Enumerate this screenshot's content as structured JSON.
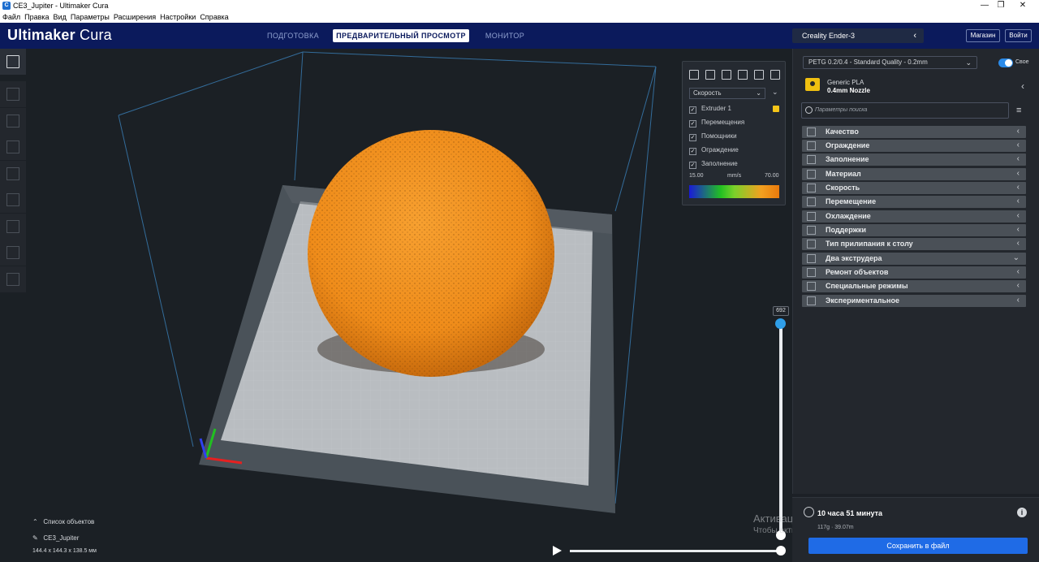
{
  "window": {
    "title": "CE3_Jupiter - Ultimaker Cura",
    "icon": "cura-app-icon",
    "controls": [
      "—",
      "❐",
      "✕"
    ]
  },
  "menu": [
    "Файл",
    "Правка",
    "Вид",
    "Параметры",
    "Расширения",
    "Настройки",
    "Справка"
  ],
  "header": {
    "logo_bold": "Ultimaker",
    "logo_light": "Cura",
    "tabs": [
      {
        "label": "ПОДГОТОВКА",
        "active": false
      },
      {
        "label": "ПРЕДВАРИТЕЛЬНЫЙ ПРОСМОТР",
        "active": true
      },
      {
        "label": "МОНИТОР",
        "active": false
      }
    ],
    "printer": "Creality Ender-3",
    "marketplace_label": "Магазин",
    "signin_label": "Войти"
  },
  "view_panel": {
    "color_scheme": "Скорость",
    "legend": [
      {
        "label": "Extruder 1",
        "checked": true,
        "swatch": "#f5c518"
      },
      {
        "label": "Перемещения",
        "checked": true
      },
      {
        "label": "Помощники",
        "checked": true
      },
      {
        "label": "Ограждение",
        "checked": true
      },
      {
        "label": "Заполнение",
        "checked": true
      }
    ],
    "scale_min": "15.00",
    "scale_unit": "mm/s",
    "scale_max": "70.00"
  },
  "layer": {
    "current": "692"
  },
  "objects": {
    "list_label": "Список объектов",
    "name": "CE3_Jupiter",
    "dimensions": "144.4 x 144.3 x 138.5 мм"
  },
  "watermark": {
    "line1": "Активация Windows",
    "line2": "Чтобы активировать Windows, перейдите в раздел \"Параметры\"."
  },
  "settings": {
    "profile": "PETG 0.2/0.4 - Standard Quality - 0.2mm",
    "custom_label": "Свое",
    "custom_enabled": true,
    "material": "Generic PLA",
    "nozzle": "0.4mm Nozzle",
    "search_placeholder": "Параметры поиска",
    "categories": [
      {
        "label": "Качество",
        "icon": "quality-icon",
        "expanded": false
      },
      {
        "label": "Ограждение",
        "icon": "shell-icon",
        "expanded": false
      },
      {
        "label": "Заполнение",
        "icon": "infill-icon",
        "expanded": false
      },
      {
        "label": "Материал",
        "icon": "material-icon",
        "expanded": false
      },
      {
        "label": "Скорость",
        "icon": "speed-icon",
        "expanded": false
      },
      {
        "label": "Перемещение",
        "icon": "travel-icon",
        "expanded": false
      },
      {
        "label": "Охлаждение",
        "icon": "cooling-icon",
        "expanded": false
      },
      {
        "label": "Поддержки",
        "icon": "support-icon",
        "expanded": false
      },
      {
        "label": "Тип прилипания к столу",
        "icon": "adhesion-icon",
        "expanded": false
      },
      {
        "label": "Два экструдера",
        "icon": "dual-extruder-icon",
        "expanded": true
      },
      {
        "label": "Ремонт объектов",
        "icon": "mesh-fix-icon",
        "expanded": false
      },
      {
        "label": "Специальные режимы",
        "icon": "special-modes-icon",
        "expanded": false
      },
      {
        "label": "Экспериментальное",
        "icon": "experimental-icon",
        "expanded": false
      }
    ]
  },
  "summary": {
    "print_time": "10 часа 51 минута",
    "material_usage": "117g · 39.07m",
    "save_label": "Сохранить в файл"
  },
  "colors": {
    "header": "#0b1a5c",
    "accent": "#1f6be6",
    "model": "#f08c1e"
  }
}
